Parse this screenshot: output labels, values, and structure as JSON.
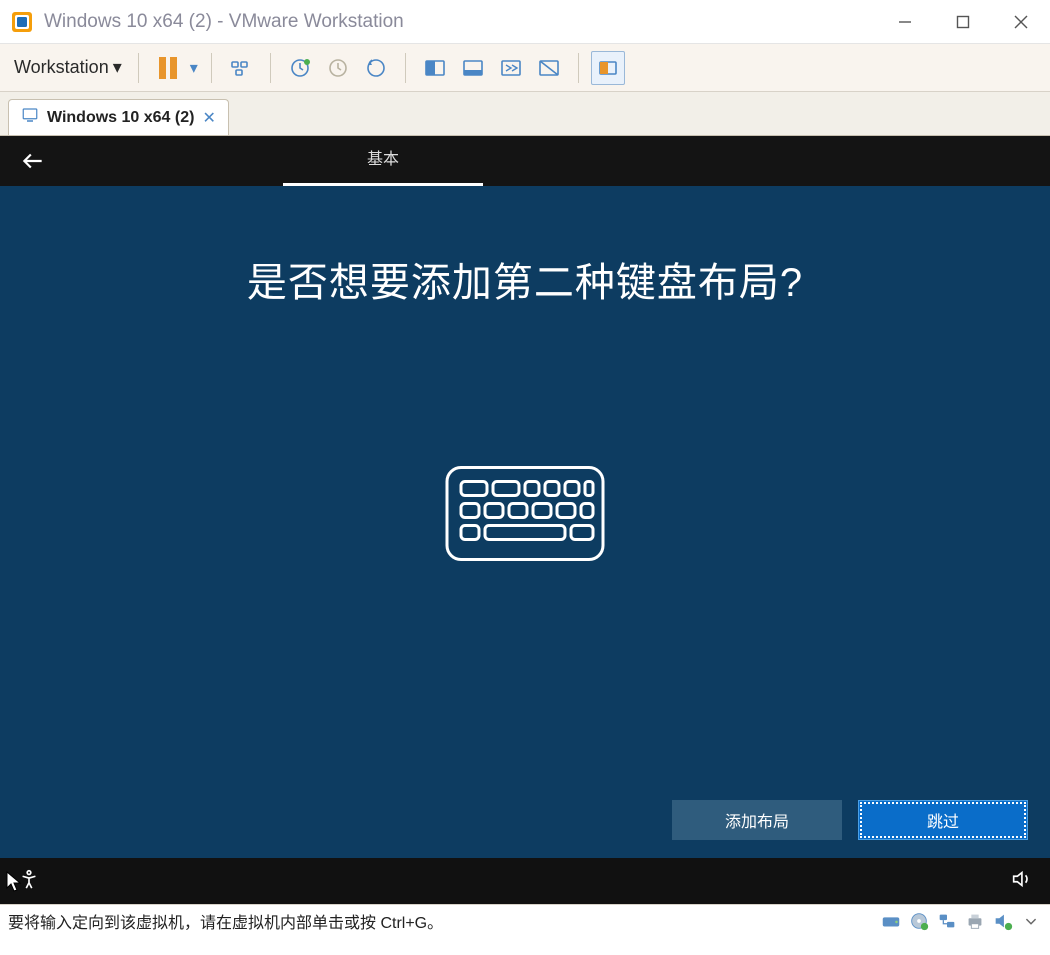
{
  "titlebar": {
    "title": "Windows 10 x64 (2) - VMware Workstation"
  },
  "toolbar": {
    "menu_label": "Workstation",
    "icons": {
      "pause": "pause-icon",
      "dropdown": "dropdown-icon",
      "send_ctrl_alt_del": "send-cad-icon",
      "snapshot_take": "snapshot-take-icon",
      "snapshot_revert": "snapshot-revert-icon",
      "snapshot_manager": "snapshot-manager-icon",
      "fullscreen": "fullscreen-icon",
      "unity": "unity-icon",
      "stretch": "stretch-icon",
      "fit": "fit-icon",
      "thumbnail": "thumbnail-icon"
    }
  },
  "tab": {
    "label": "Windows 10 x64 (2)"
  },
  "oobe": {
    "nav_tab": "基本",
    "title": "是否想要添加第二种键盘布局?",
    "btn_add": "添加布局",
    "btn_skip": "跳过"
  },
  "statusbar": {
    "message": "要将输入定向到该虚拟机，请在虚拟机内部单击或按 Ctrl+G。"
  },
  "colors": {
    "accent_blue": "#0a6dc9",
    "oobe_bg": "#0d3c61",
    "pause_orange": "#e8952c"
  }
}
